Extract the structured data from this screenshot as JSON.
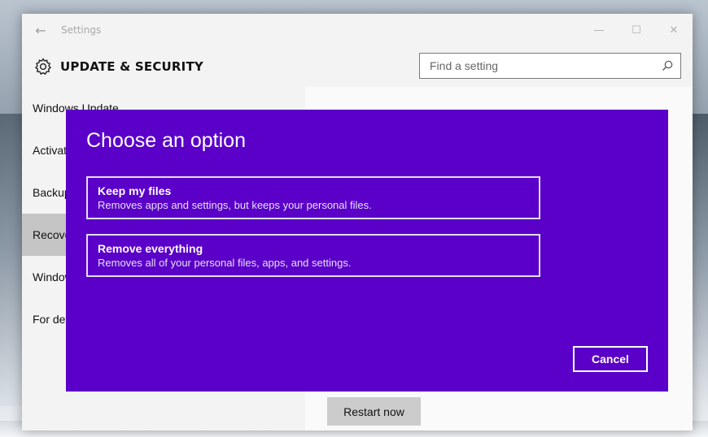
{
  "window": {
    "title": "Settings",
    "back_glyph": "←",
    "minimize_glyph": "—",
    "maximize_glyph": "☐",
    "close_glyph": "✕"
  },
  "header": {
    "title": "UPDATE & SECURITY",
    "icon": "gear-icon",
    "search_placeholder": "Find a setting"
  },
  "sidebar": {
    "items": [
      {
        "label": "Windows Update"
      },
      {
        "label": "Activation"
      },
      {
        "label": "Backup"
      },
      {
        "label": "Recovery"
      },
      {
        "label": "Windows Defender"
      },
      {
        "label": "For developers"
      }
    ],
    "selected_index": 3
  },
  "content": {
    "restart_label": "Restart now"
  },
  "dialog": {
    "title": "Choose an option",
    "options": [
      {
        "title": "Keep my files",
        "description": "Removes apps and settings, but keeps your personal files."
      },
      {
        "title": "Remove everything",
        "description": "Removes all of your personal files, apps, and settings."
      }
    ],
    "cancel_label": "Cancel",
    "background_color": "#5a00c8"
  }
}
